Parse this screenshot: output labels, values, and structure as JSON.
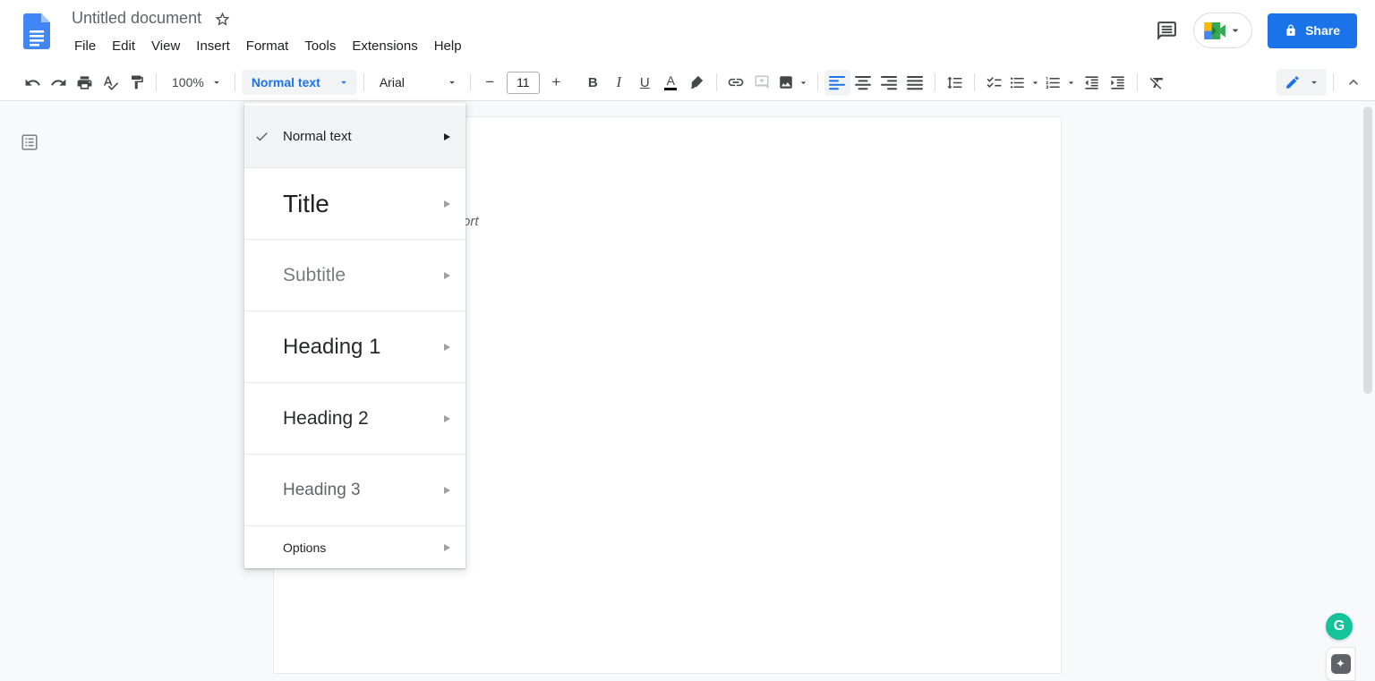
{
  "header": {
    "doc_title": "Untitled document",
    "menus": [
      "File",
      "Edit",
      "View",
      "Insert",
      "Format",
      "Tools",
      "Extensions",
      "Help"
    ],
    "share_label": "Share"
  },
  "toolbar": {
    "zoom_value": "100%",
    "styles_value": "Normal text",
    "font_value": "Arial",
    "font_size_value": "11",
    "glyphs": {
      "minus": "−",
      "plus": "+",
      "bold": "B",
      "italic": "I",
      "underline": "U",
      "text_color": "A"
    }
  },
  "styles_menu": {
    "items": [
      {
        "label": "Normal text",
        "checked": true
      },
      {
        "label": "Title"
      },
      {
        "label": "Subtitle"
      },
      {
        "label": "Heading 1"
      },
      {
        "label": "Heading 2"
      },
      {
        "label": "Heading 3"
      },
      {
        "label": "Options"
      }
    ]
  },
  "document": {
    "visible_text_fragment": "ort"
  },
  "widgets": {
    "grammarly_glyph": "G",
    "assistant_glyph": "✦"
  },
  "colors": {
    "accent_blue": "#1a73e8",
    "grammarly_green": "#15c39a",
    "toolbar_icon": "#444746",
    "canvas_bg": "#f8f9fa"
  }
}
